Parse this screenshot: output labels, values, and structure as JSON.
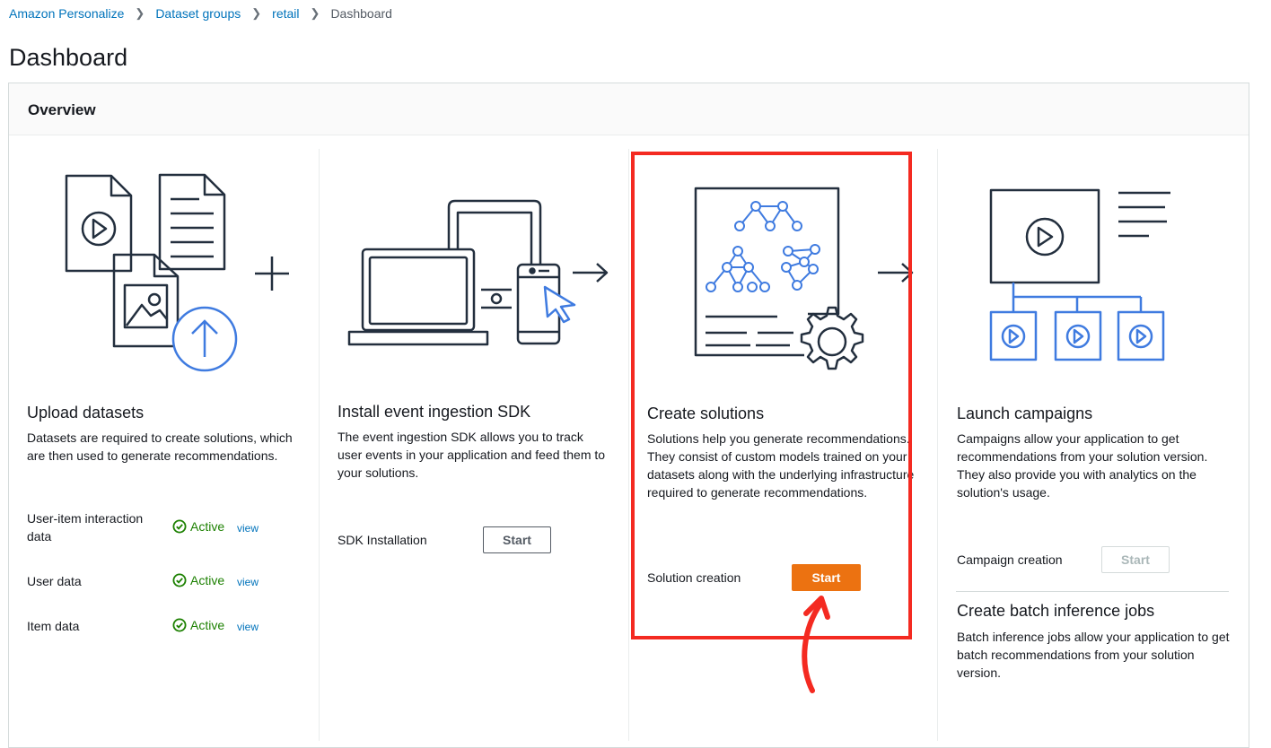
{
  "breadcrumb": {
    "items": [
      "Amazon Personalize",
      "Dataset groups",
      "retail"
    ],
    "current": "Dashboard"
  },
  "page": {
    "title": "Dashboard"
  },
  "overview": {
    "title": "Overview",
    "upload": {
      "title": "Upload datasets",
      "description": "Datasets are required to create solutions, which are then used to generate recommendations.",
      "rows": [
        {
          "label": "User-item interaction data",
          "status": "Active",
          "link": "view"
        },
        {
          "label": "User data",
          "status": "Active",
          "link": "view"
        },
        {
          "label": "Item data",
          "status": "Active",
          "link": "view"
        }
      ]
    },
    "sdk": {
      "title": "Install event ingestion SDK",
      "description": "The event ingestion SDK allows you to track user events in your application and feed them to your solutions.",
      "row_label": "SDK Installation",
      "button": "Start"
    },
    "solutions": {
      "title": "Create solutions",
      "description": "Solutions help you generate recommendations. They consist of custom models trained on your datasets along with the underlying infrastructure required to generate recommendations.",
      "row_label": "Solution creation",
      "button": "Start"
    },
    "campaigns": {
      "title": "Launch campaigns",
      "description": "Campaigns allow your application to get recommendations from your solution version. They also provide you with analytics on the solution's usage.",
      "row_label": "Campaign creation",
      "button": "Start"
    },
    "batch": {
      "title": "Create batch inference jobs",
      "description": "Batch inference jobs allow your application to get batch recommendations from your solution version."
    }
  },
  "colors": {
    "link": "#0073bb",
    "active": "#1d8102",
    "primary_button": "#ec7211",
    "icon_dark": "#232f3e",
    "icon_blue": "#3f7be0",
    "annotation_red": "#f42a21"
  },
  "icons": [
    "chevron-right-icon",
    "check-circle-icon",
    "upload-datasets-illustration",
    "sdk-devices-illustration",
    "solutions-illustration",
    "campaigns-illustration",
    "arrow-right-icon"
  ]
}
